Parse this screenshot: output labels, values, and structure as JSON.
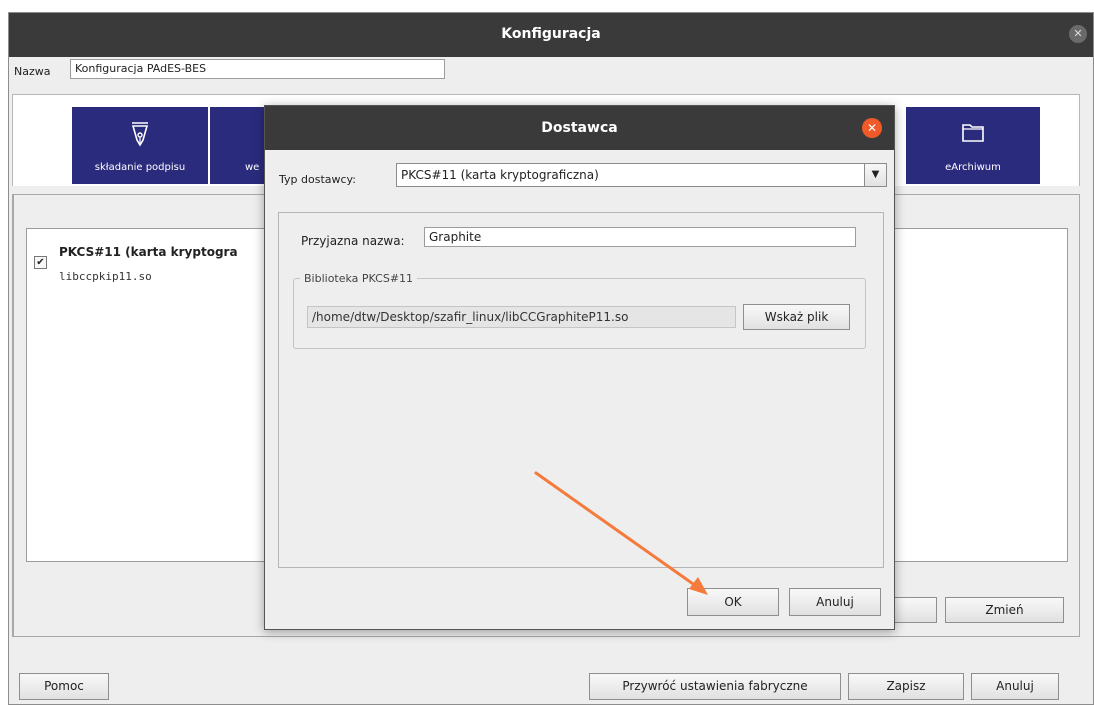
{
  "main_window": {
    "title": "Konfiguracja",
    "close_glyph": "✕",
    "name_label": "Nazwa",
    "name_value": "Konfiguracja PAdES-BES",
    "tabs": [
      {
        "label": "składanie podpisu",
        "icon": "pen-nib-icon"
      },
      {
        "label": "we",
        "icon": "unknown-icon"
      },
      {
        "label": "eArchiwum",
        "icon": "folder-icon"
      }
    ],
    "provider_list": {
      "items": [
        {
          "name": "PKCS#11 (karta kryptogra",
          "library": "libccpkip11.so",
          "checked": true,
          "check_glyph": "✔"
        }
      ]
    },
    "right_buttons": {
      "zmien": "Zmień"
    },
    "footer": {
      "help": "Pomoc",
      "restore": "Przywróć ustawienia fabryczne",
      "save": "Zapisz",
      "cancel": "Anuluj"
    }
  },
  "dialog": {
    "title": "Dostawca",
    "close_glyph": "✕",
    "type_label": "Typ dostawcy:",
    "type_value": "PKCS#11 (karta kryptograficzna)",
    "dropdown_glyph": "▼",
    "friendly_name_label": "Przyjazna nazwa:",
    "friendly_name_value": "Graphite",
    "library_group_label": "Biblioteka PKCS#11",
    "library_path": "/home/dtw/Desktop/szafir_linux/libCCGraphiteP11.so",
    "browse_button": "Wskaż plik",
    "ok_button": "OK",
    "cancel_button": "Anuluj"
  },
  "annotation": {
    "arrow_color": "#f47b3c"
  },
  "colors": {
    "tab_bg": "#2b2b7e",
    "titlebar": "#3a3a3a",
    "dialog_close": "#f05a28"
  }
}
